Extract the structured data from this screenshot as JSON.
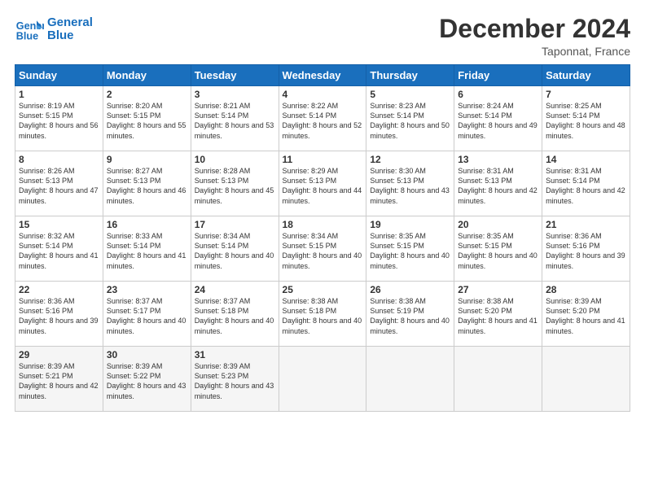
{
  "logo": {
    "line1": "General",
    "line2": "Blue"
  },
  "title": "December 2024",
  "location": "Taponnat, France",
  "headers": [
    "Sunday",
    "Monday",
    "Tuesday",
    "Wednesday",
    "Thursday",
    "Friday",
    "Saturday"
  ],
  "weeks": [
    [
      {
        "day": "1",
        "sunrise": "Sunrise: 8:19 AM",
        "sunset": "Sunset: 5:15 PM",
        "daylight": "Daylight: 8 hours and 56 minutes."
      },
      {
        "day": "2",
        "sunrise": "Sunrise: 8:20 AM",
        "sunset": "Sunset: 5:15 PM",
        "daylight": "Daylight: 8 hours and 55 minutes."
      },
      {
        "day": "3",
        "sunrise": "Sunrise: 8:21 AM",
        "sunset": "Sunset: 5:14 PM",
        "daylight": "Daylight: 8 hours and 53 minutes."
      },
      {
        "day": "4",
        "sunrise": "Sunrise: 8:22 AM",
        "sunset": "Sunset: 5:14 PM",
        "daylight": "Daylight: 8 hours and 52 minutes."
      },
      {
        "day": "5",
        "sunrise": "Sunrise: 8:23 AM",
        "sunset": "Sunset: 5:14 PM",
        "daylight": "Daylight: 8 hours and 50 minutes."
      },
      {
        "day": "6",
        "sunrise": "Sunrise: 8:24 AM",
        "sunset": "Sunset: 5:14 PM",
        "daylight": "Daylight: 8 hours and 49 minutes."
      },
      {
        "day": "7",
        "sunrise": "Sunrise: 8:25 AM",
        "sunset": "Sunset: 5:14 PM",
        "daylight": "Daylight: 8 hours and 48 minutes."
      }
    ],
    [
      {
        "day": "8",
        "sunrise": "Sunrise: 8:26 AM",
        "sunset": "Sunset: 5:13 PM",
        "daylight": "Daylight: 8 hours and 47 minutes."
      },
      {
        "day": "9",
        "sunrise": "Sunrise: 8:27 AM",
        "sunset": "Sunset: 5:13 PM",
        "daylight": "Daylight: 8 hours and 46 minutes."
      },
      {
        "day": "10",
        "sunrise": "Sunrise: 8:28 AM",
        "sunset": "Sunset: 5:13 PM",
        "daylight": "Daylight: 8 hours and 45 minutes."
      },
      {
        "day": "11",
        "sunrise": "Sunrise: 8:29 AM",
        "sunset": "Sunset: 5:13 PM",
        "daylight": "Daylight: 8 hours and 44 minutes."
      },
      {
        "day": "12",
        "sunrise": "Sunrise: 8:30 AM",
        "sunset": "Sunset: 5:13 PM",
        "daylight": "Daylight: 8 hours and 43 minutes."
      },
      {
        "day": "13",
        "sunrise": "Sunrise: 8:31 AM",
        "sunset": "Sunset: 5:13 PM",
        "daylight": "Daylight: 8 hours and 42 minutes."
      },
      {
        "day": "14",
        "sunrise": "Sunrise: 8:31 AM",
        "sunset": "Sunset: 5:14 PM",
        "daylight": "Daylight: 8 hours and 42 minutes."
      }
    ],
    [
      {
        "day": "15",
        "sunrise": "Sunrise: 8:32 AM",
        "sunset": "Sunset: 5:14 PM",
        "daylight": "Daylight: 8 hours and 41 minutes."
      },
      {
        "day": "16",
        "sunrise": "Sunrise: 8:33 AM",
        "sunset": "Sunset: 5:14 PM",
        "daylight": "Daylight: 8 hours and 41 minutes."
      },
      {
        "day": "17",
        "sunrise": "Sunrise: 8:34 AM",
        "sunset": "Sunset: 5:14 PM",
        "daylight": "Daylight: 8 hours and 40 minutes."
      },
      {
        "day": "18",
        "sunrise": "Sunrise: 8:34 AM",
        "sunset": "Sunset: 5:15 PM",
        "daylight": "Daylight: 8 hours and 40 minutes."
      },
      {
        "day": "19",
        "sunrise": "Sunrise: 8:35 AM",
        "sunset": "Sunset: 5:15 PM",
        "daylight": "Daylight: 8 hours and 40 minutes."
      },
      {
        "day": "20",
        "sunrise": "Sunrise: 8:35 AM",
        "sunset": "Sunset: 5:15 PM",
        "daylight": "Daylight: 8 hours and 40 minutes."
      },
      {
        "day": "21",
        "sunrise": "Sunrise: 8:36 AM",
        "sunset": "Sunset: 5:16 PM",
        "daylight": "Daylight: 8 hours and 39 minutes."
      }
    ],
    [
      {
        "day": "22",
        "sunrise": "Sunrise: 8:36 AM",
        "sunset": "Sunset: 5:16 PM",
        "daylight": "Daylight: 8 hours and 39 minutes."
      },
      {
        "day": "23",
        "sunrise": "Sunrise: 8:37 AM",
        "sunset": "Sunset: 5:17 PM",
        "daylight": "Daylight: 8 hours and 40 minutes."
      },
      {
        "day": "24",
        "sunrise": "Sunrise: 8:37 AM",
        "sunset": "Sunset: 5:18 PM",
        "daylight": "Daylight: 8 hours and 40 minutes."
      },
      {
        "day": "25",
        "sunrise": "Sunrise: 8:38 AM",
        "sunset": "Sunset: 5:18 PM",
        "daylight": "Daylight: 8 hours and 40 minutes."
      },
      {
        "day": "26",
        "sunrise": "Sunrise: 8:38 AM",
        "sunset": "Sunset: 5:19 PM",
        "daylight": "Daylight: 8 hours and 40 minutes."
      },
      {
        "day": "27",
        "sunrise": "Sunrise: 8:38 AM",
        "sunset": "Sunset: 5:20 PM",
        "daylight": "Daylight: 8 hours and 41 minutes."
      },
      {
        "day": "28",
        "sunrise": "Sunrise: 8:39 AM",
        "sunset": "Sunset: 5:20 PM",
        "daylight": "Daylight: 8 hours and 41 minutes."
      }
    ],
    [
      {
        "day": "29",
        "sunrise": "Sunrise: 8:39 AM",
        "sunset": "Sunset: 5:21 PM",
        "daylight": "Daylight: 8 hours and 42 minutes."
      },
      {
        "day": "30",
        "sunrise": "Sunrise: 8:39 AM",
        "sunset": "Sunset: 5:22 PM",
        "daylight": "Daylight: 8 hours and 43 minutes."
      },
      {
        "day": "31",
        "sunrise": "Sunrise: 8:39 AM",
        "sunset": "Sunset: 5:23 PM",
        "daylight": "Daylight: 8 hours and 43 minutes."
      },
      null,
      null,
      null,
      null
    ]
  ]
}
